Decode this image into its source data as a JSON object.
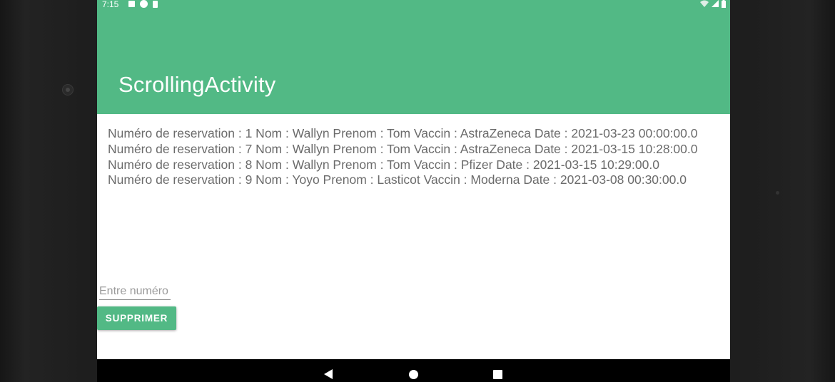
{
  "status_bar": {
    "time": "7:15",
    "left_icons": [
      "a-notification-icon",
      "p-notification-icon",
      "sd-card-icon"
    ],
    "right_icons": [
      "wifi-icon",
      "signal-icon",
      "battery-icon"
    ]
  },
  "app_bar": {
    "title": "ScrollingActivity",
    "color": "#52b985"
  },
  "reservations": [
    "Numéro de reservation : 1 Nom : Wallyn Prenom : Tom Vaccin : AstraZeneca Date : 2021-03-23 00:00:00.0",
    "Numéro de reservation : 7 Nom : Wallyn Prenom : Tom Vaccin : AstraZeneca Date : 2021-03-15 10:28:00.0",
    "Numéro de reservation : 8 Nom : Wallyn Prenom : Tom Vaccin : Pfizer Date : 2021-03-15 10:29:00.0",
    "Numéro de reservation : 9 Nom : Yoyo Prenom : Lasticot Vaccin : Moderna Date : 2021-03-08 00:30:00.0"
  ],
  "form": {
    "number_placeholder": "Entre numéro",
    "number_value": "",
    "delete_label": "SUPPRIMER"
  },
  "nav_bar": {
    "buttons": [
      "back-icon",
      "home-icon",
      "recent-apps-icon"
    ]
  }
}
